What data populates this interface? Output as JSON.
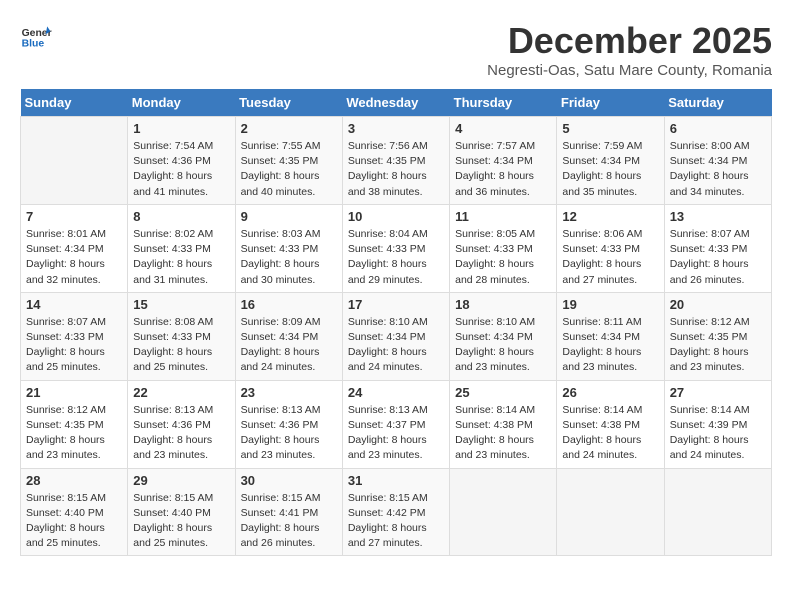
{
  "logo": {
    "text_general": "General",
    "text_blue": "Blue"
  },
  "title": "December 2025",
  "subtitle": "Negresti-Oas, Satu Mare County, Romania",
  "days_of_week": [
    "Sunday",
    "Monday",
    "Tuesday",
    "Wednesday",
    "Thursday",
    "Friday",
    "Saturday"
  ],
  "weeks": [
    [
      {
        "day": "",
        "empty": true
      },
      {
        "day": "1",
        "sunrise": "7:54 AM",
        "sunset": "4:36 PM",
        "daylight": "8 hours and 41 minutes."
      },
      {
        "day": "2",
        "sunrise": "7:55 AM",
        "sunset": "4:35 PM",
        "daylight": "8 hours and 40 minutes."
      },
      {
        "day": "3",
        "sunrise": "7:56 AM",
        "sunset": "4:35 PM",
        "daylight": "8 hours and 38 minutes."
      },
      {
        "day": "4",
        "sunrise": "7:57 AM",
        "sunset": "4:34 PM",
        "daylight": "8 hours and 36 minutes."
      },
      {
        "day": "5",
        "sunrise": "7:59 AM",
        "sunset": "4:34 PM",
        "daylight": "8 hours and 35 minutes."
      },
      {
        "day": "6",
        "sunrise": "8:00 AM",
        "sunset": "4:34 PM",
        "daylight": "8 hours and 34 minutes."
      }
    ],
    [
      {
        "day": "7",
        "sunrise": "8:01 AM",
        "sunset": "4:34 PM",
        "daylight": "8 hours and 32 minutes."
      },
      {
        "day": "8",
        "sunrise": "8:02 AM",
        "sunset": "4:33 PM",
        "daylight": "8 hours and 31 minutes."
      },
      {
        "day": "9",
        "sunrise": "8:03 AM",
        "sunset": "4:33 PM",
        "daylight": "8 hours and 30 minutes."
      },
      {
        "day": "10",
        "sunrise": "8:04 AM",
        "sunset": "4:33 PM",
        "daylight": "8 hours and 29 minutes."
      },
      {
        "day": "11",
        "sunrise": "8:05 AM",
        "sunset": "4:33 PM",
        "daylight": "8 hours and 28 minutes."
      },
      {
        "day": "12",
        "sunrise": "8:06 AM",
        "sunset": "4:33 PM",
        "daylight": "8 hours and 27 minutes."
      },
      {
        "day": "13",
        "sunrise": "8:07 AM",
        "sunset": "4:33 PM",
        "daylight": "8 hours and 26 minutes."
      }
    ],
    [
      {
        "day": "14",
        "sunrise": "8:07 AM",
        "sunset": "4:33 PM",
        "daylight": "8 hours and 25 minutes."
      },
      {
        "day": "15",
        "sunrise": "8:08 AM",
        "sunset": "4:33 PM",
        "daylight": "8 hours and 25 minutes."
      },
      {
        "day": "16",
        "sunrise": "8:09 AM",
        "sunset": "4:34 PM",
        "daylight": "8 hours and 24 minutes."
      },
      {
        "day": "17",
        "sunrise": "8:10 AM",
        "sunset": "4:34 PM",
        "daylight": "8 hours and 24 minutes."
      },
      {
        "day": "18",
        "sunrise": "8:10 AM",
        "sunset": "4:34 PM",
        "daylight": "8 hours and 23 minutes."
      },
      {
        "day": "19",
        "sunrise": "8:11 AM",
        "sunset": "4:34 PM",
        "daylight": "8 hours and 23 minutes."
      },
      {
        "day": "20",
        "sunrise": "8:12 AM",
        "sunset": "4:35 PM",
        "daylight": "8 hours and 23 minutes."
      }
    ],
    [
      {
        "day": "21",
        "sunrise": "8:12 AM",
        "sunset": "4:35 PM",
        "daylight": "8 hours and 23 minutes."
      },
      {
        "day": "22",
        "sunrise": "8:13 AM",
        "sunset": "4:36 PM",
        "daylight": "8 hours and 23 minutes."
      },
      {
        "day": "23",
        "sunrise": "8:13 AM",
        "sunset": "4:36 PM",
        "daylight": "8 hours and 23 minutes."
      },
      {
        "day": "24",
        "sunrise": "8:13 AM",
        "sunset": "4:37 PM",
        "daylight": "8 hours and 23 minutes."
      },
      {
        "day": "25",
        "sunrise": "8:14 AM",
        "sunset": "4:38 PM",
        "daylight": "8 hours and 23 minutes."
      },
      {
        "day": "26",
        "sunrise": "8:14 AM",
        "sunset": "4:38 PM",
        "daylight": "8 hours and 24 minutes."
      },
      {
        "day": "27",
        "sunrise": "8:14 AM",
        "sunset": "4:39 PM",
        "daylight": "8 hours and 24 minutes."
      }
    ],
    [
      {
        "day": "28",
        "sunrise": "8:15 AM",
        "sunset": "4:40 PM",
        "daylight": "8 hours and 25 minutes."
      },
      {
        "day": "29",
        "sunrise": "8:15 AM",
        "sunset": "4:40 PM",
        "daylight": "8 hours and 25 minutes."
      },
      {
        "day": "30",
        "sunrise": "8:15 AM",
        "sunset": "4:41 PM",
        "daylight": "8 hours and 26 minutes."
      },
      {
        "day": "31",
        "sunrise": "8:15 AM",
        "sunset": "4:42 PM",
        "daylight": "8 hours and 27 minutes."
      },
      {
        "day": "",
        "empty": true
      },
      {
        "day": "",
        "empty": true
      },
      {
        "day": "",
        "empty": true
      }
    ]
  ]
}
